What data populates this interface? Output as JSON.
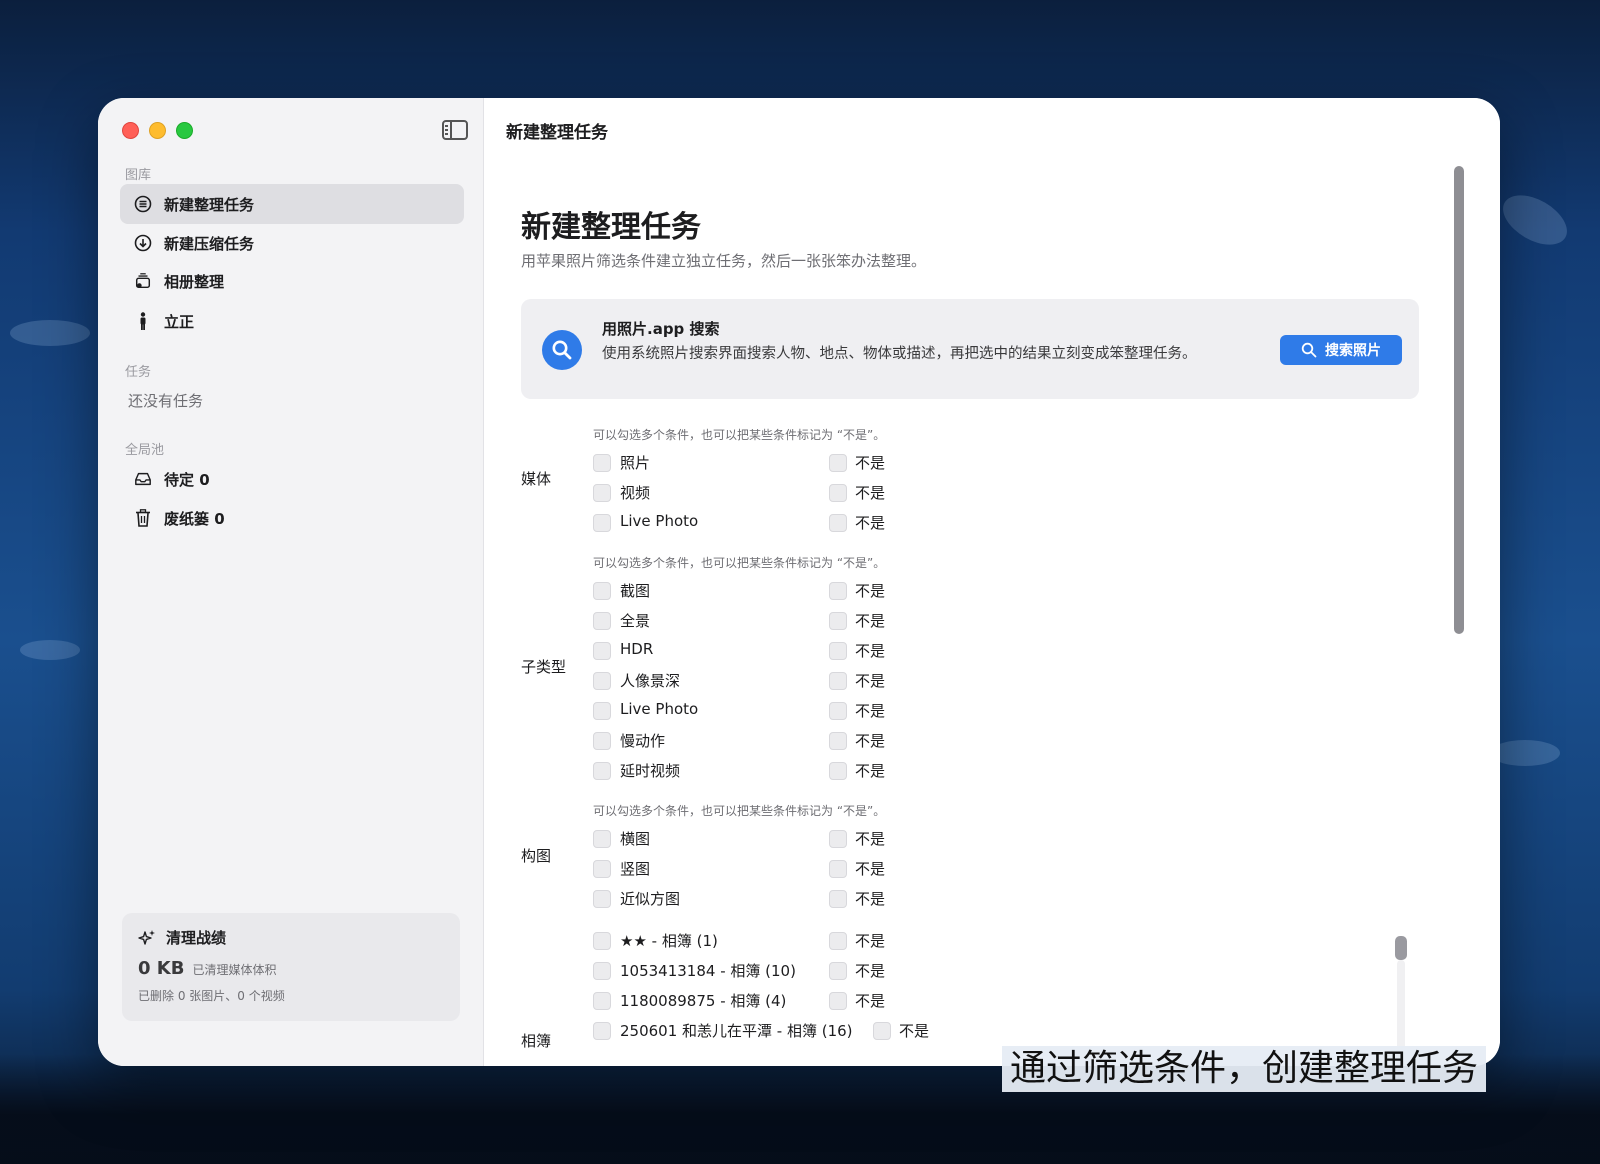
{
  "window": {
    "toolbar_title": "新建整理任务"
  },
  "sidebar": {
    "sections": {
      "library": "图库",
      "tasks": "任务",
      "global_pool": "全局池"
    },
    "library_items": [
      {
        "label": "新建整理任务",
        "icon": "list-circle-icon",
        "active": true
      },
      {
        "label": "新建压缩任务",
        "icon": "download-circle-icon",
        "active": false
      },
      {
        "label": "相册整理",
        "icon": "album-stack-icon",
        "active": false
      },
      {
        "label": "立正",
        "icon": "standing-person-icon",
        "active": false
      }
    ],
    "tasks_empty": "还没有任务",
    "pool_items": [
      {
        "label": "待定 0",
        "icon": "inbox-tray-icon"
      },
      {
        "label": "废纸篓 0",
        "icon": "trash-icon"
      }
    ],
    "stats": {
      "title": "清理战绩",
      "size": "0 KB",
      "size_caption": "已清理媒体体积",
      "detail": "已删除 0 张图片、0 个视频"
    }
  },
  "main": {
    "title": "新建整理任务",
    "subtitle": "用苹果照片筛选条件建立独立任务，然后一张张笨办法整理。",
    "search_card": {
      "title": "用照片.app 搜索",
      "description": "使用系统照片搜索界面搜索人物、地点、物体或描述，再把选中的结果立刻变成笨整理任务。",
      "button_label": "搜索照片"
    },
    "hint": "可以勾选多个条件，也可以把某些条件标记为 “不是”。",
    "not_label": "不是",
    "groups": {
      "media": {
        "label": "媒体",
        "options": [
          "照片",
          "视频",
          "Live Photo"
        ]
      },
      "subtype": {
        "label": "子类型",
        "options": [
          "截图",
          "全景",
          "HDR",
          "人像景深",
          "Live Photo",
          "慢动作",
          "延时视频"
        ]
      },
      "composition": {
        "label": "构图",
        "options": [
          "横图",
          "竖图",
          "近似方图"
        ]
      },
      "albums": {
        "label": "相簿",
        "options": [
          "★★ - 相簿 (1)",
          "1053413184 - 相簿 (10)",
          "1180089875 - 相簿 (4)",
          "250601 和恙儿在平潭 - 相簿 (16)"
        ]
      }
    }
  },
  "caption": "通过筛选条件，创建整理任务",
  "colors": {
    "accent": "#2f7be8",
    "sidebar_bg": "#f3f3f5",
    "active_item": "#dedee2"
  }
}
